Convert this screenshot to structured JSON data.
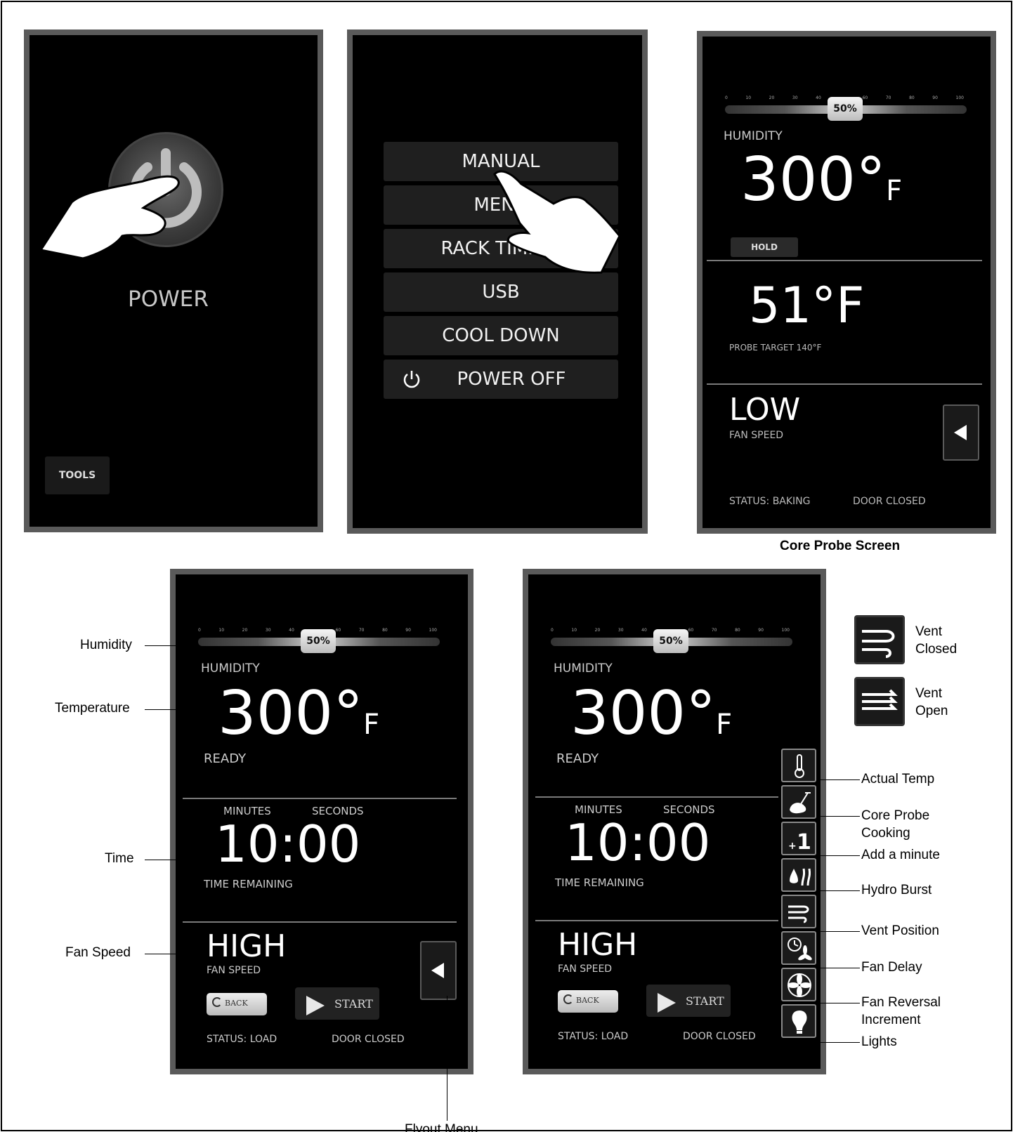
{
  "screen1": {
    "power_label": "POWER",
    "tools_label": "TOOLS"
  },
  "screen2": {
    "menu_items": [
      "MANUAL",
      "MENU",
      "RACK TIMING",
      "USB",
      "COOL DOWN",
      "POWER OFF"
    ]
  },
  "humidity_scale": [
    "0",
    "10",
    "20",
    "30",
    "40",
    "50",
    "60",
    "70",
    "80",
    "90",
    "100"
  ],
  "humidity_value": "50%",
  "humidity_label": "HUMIDITY",
  "screen3": {
    "temp_value": "300°",
    "temp_unit": "F",
    "hold_label": "HOLD",
    "probe_temp": "51°F",
    "probe_target": "PROBE TARGET 140°F",
    "fan_value": "LOW",
    "fan_label": "FAN SPEED",
    "status": "STATUS: BAKING",
    "door": "DOOR CLOSED",
    "caption": "Core Probe Screen"
  },
  "main_screen": {
    "temp_value": "300°",
    "temp_unit": "F",
    "ready": "READY",
    "minutes_label": "MINUTES",
    "seconds_label": "SECONDS",
    "time_value": "10:00",
    "time_remaining": "TIME REMAINING",
    "fan_value": "HIGH",
    "fan_label": "FAN SPEED",
    "back_label": "BACK",
    "start_label": "START",
    "status": "STATUS: LOAD",
    "door": "DOOR CLOSED"
  },
  "annotations_left": {
    "humidity": "Humidity",
    "temperature": "Temperature",
    "time": "Time",
    "fan_speed": "Fan Speed",
    "flyout_menu": "Flyout Menu"
  },
  "legend": {
    "vent_closed_1": "Vent",
    "vent_closed_2": "Closed",
    "vent_open_1": "Vent",
    "vent_open_2": "Open"
  },
  "annotations_right": {
    "actual_temp": "Actual Temp",
    "core_probe_1": "Core Probe",
    "core_probe_2": "Cooking",
    "add_minute": "Add a minute",
    "hydro_burst": "Hydro Burst",
    "vent_position": "Vent Position",
    "fan_delay": "Fan Delay",
    "fan_reversal_1": "Fan Reversal",
    "fan_reversal_2": "Increment",
    "lights": "Lights"
  },
  "icons": [
    "power-icon",
    "hand-pointer-icon",
    "thermometer-icon",
    "meat-probe-icon",
    "plus-one-icon",
    "hydro-burst-icon",
    "vent-icon",
    "fan-delay-icon",
    "fan-icon",
    "light-bulb-icon",
    "back-icon",
    "play-icon",
    "flyout-arrow-icon"
  ]
}
